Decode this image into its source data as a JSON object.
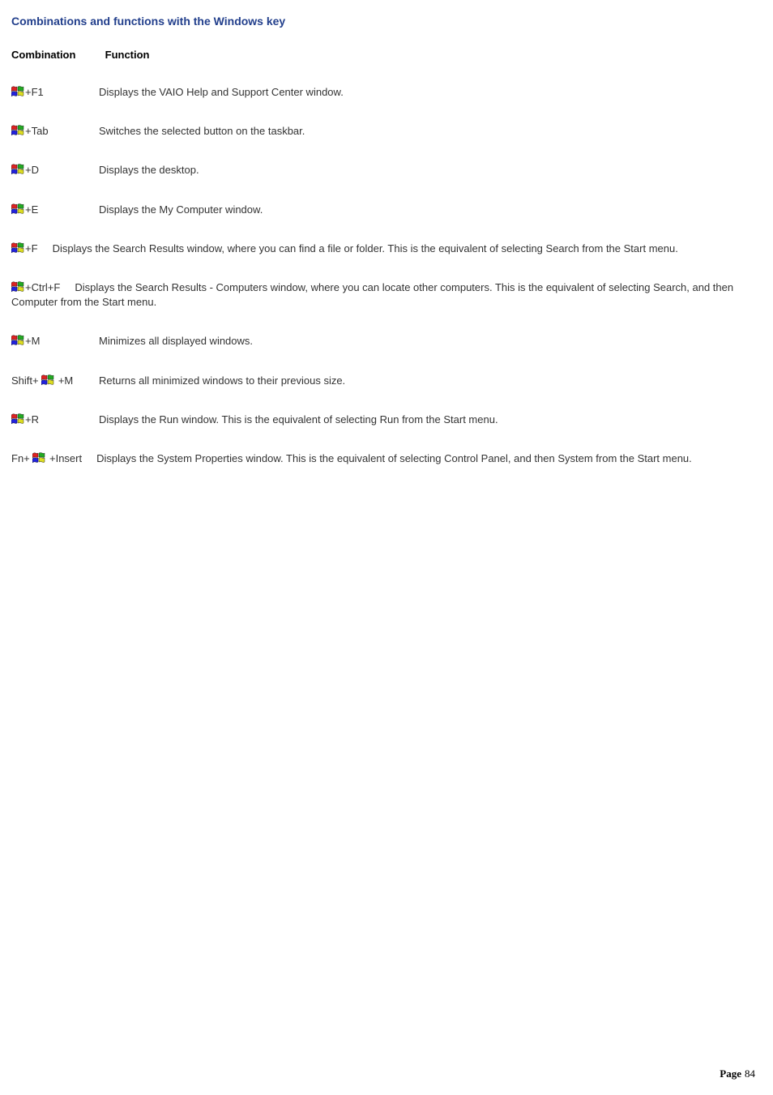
{
  "title": "Combinations and functions with the Windows key",
  "head": {
    "col1": "Combination",
    "col2": "Function"
  },
  "rows": [
    {
      "prefix": "",
      "suffix": "+F1",
      "func": "Displays the VAIO Help and Support Center window.",
      "mode": "fixed"
    },
    {
      "prefix": "",
      "suffix": "+Tab",
      "func": "Switches the selected button on the taskbar.",
      "mode": "fixed"
    },
    {
      "prefix": "",
      "suffix": "+D",
      "func": "Displays the desktop.",
      "mode": "fixed"
    },
    {
      "prefix": "",
      "suffix": "+E",
      "func": "Displays the My Computer window.",
      "mode": "fixed"
    },
    {
      "prefix": "",
      "suffix": "+F",
      "func": "Displays the Search Results window, where you can find a file or folder. This is the equivalent of selecting Search from the Start menu.",
      "mode": "wrap"
    },
    {
      "prefix": "",
      "suffix": "+Ctrl+F",
      "func": "Displays the Search Results - Computers window, where you can locate other computers. This is the equivalent of selecting Search, and then Computer from the Start menu.",
      "mode": "wrap"
    },
    {
      "prefix": "",
      "suffix": "+M",
      "func": "Minimizes all displayed windows.",
      "mode": "fixed"
    },
    {
      "prefix": "Shift+ ",
      "suffix": " +M",
      "func": "Returns all minimized windows to their previous size.",
      "mode": "fixed"
    },
    {
      "prefix": "",
      "suffix": "+R",
      "func": "Displays the Run window. This is the equivalent of selecting Run from the Start menu.",
      "mode": "fixed"
    },
    {
      "prefix": "Fn+ ",
      "suffix": " +Insert",
      "func": "Displays the System Properties window. This is the equivalent of selecting Control Panel, and then System from the Start menu.",
      "mode": "wrap"
    }
  ],
  "page": {
    "label": "Page",
    "num": "84"
  }
}
